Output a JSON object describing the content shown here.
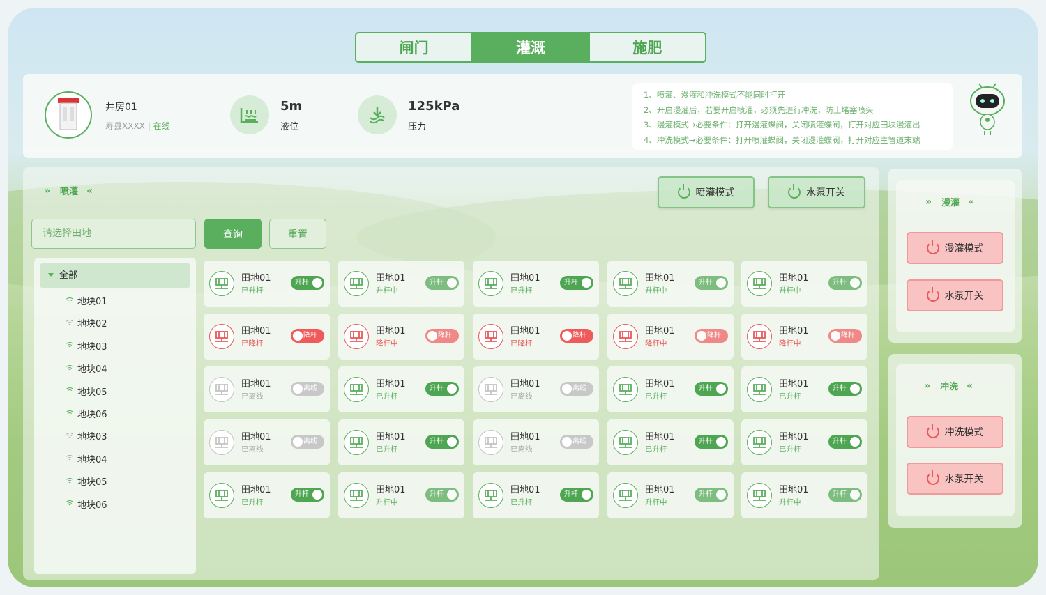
{
  "tabs": [
    {
      "label": "闸门"
    },
    {
      "label": "灌溉",
      "active": true
    },
    {
      "label": "施肥"
    }
  ],
  "header": {
    "station_name": "井房01",
    "location": "寿县XXXX",
    "separator": "|",
    "status": "在线",
    "level_value": "5m",
    "level_label": "液位",
    "pressure_value": "125kPa",
    "pressure_label": "压力",
    "notes": [
      "1、喷灌、漫灌和冲洗模式不能同时打开",
      "2、开启漫灌后，若要开启喷灌，必须先进行冲洗，防止堵塞喷头",
      "3、漫灌模式→必要条件：打开漫灌蝶阀，关闭喷灌蝶阀，打开对应田块漫灌出",
      "4、冲洗模式→必要条件：打开喷灌蝶阀，关闭漫灌蝶阀，打开对应主管道末端"
    ]
  },
  "spray": {
    "title": "喷灌",
    "mode_btn": "喷灌模式",
    "pump_btn": "水泵开关",
    "field_placeholder": "请选择田地",
    "query_btn": "查询",
    "reset_btn": "重置",
    "tree_all": "全部",
    "tree_items": [
      {
        "label": "地块01",
        "online": true
      },
      {
        "label": "地块02",
        "online": false
      },
      {
        "label": "地块03",
        "online": true
      },
      {
        "label": "地块04",
        "online": true
      },
      {
        "label": "地块05",
        "online": true
      },
      {
        "label": "地块06",
        "online": true
      },
      {
        "label": "地块03",
        "online": false
      },
      {
        "label": "地块04",
        "online": false
      },
      {
        "label": "地块05",
        "online": true
      },
      {
        "label": "地块06",
        "online": true
      }
    ]
  },
  "flood": {
    "title": "漫灌",
    "mode_btn": "漫灌模式",
    "pump_btn": "水泵开关"
  },
  "flush": {
    "title": "冲洗",
    "mode_btn": "冲洗模式",
    "pump_btn": "水泵开关"
  },
  "cards": [
    [
      {
        "name": "田地01",
        "status": "已升杆",
        "toggle": "升杆",
        "kind": "up"
      },
      {
        "name": "田地01",
        "status": "升杆中",
        "toggle": "升杆",
        "kind": "up-pending"
      },
      {
        "name": "田地01",
        "status": "已升杆",
        "toggle": "升杆",
        "kind": "up"
      },
      {
        "name": "田地01",
        "status": "升杆中",
        "toggle": "升杆",
        "kind": "up-pending"
      },
      {
        "name": "田地01",
        "status": "升杆中",
        "toggle": "升杆",
        "kind": "up-pending"
      }
    ],
    [
      {
        "name": "田地01",
        "status": "已降杆",
        "toggle": "降杆",
        "kind": "down"
      },
      {
        "name": "田地01",
        "status": "降杆中",
        "toggle": "降杆",
        "kind": "down-pending"
      },
      {
        "name": "田地01",
        "status": "已降杆",
        "toggle": "降杆",
        "kind": "down"
      },
      {
        "name": "田地01",
        "status": "降杆中",
        "toggle": "降杆",
        "kind": "down-pending"
      },
      {
        "name": "田地01",
        "status": "降杆中",
        "toggle": "降杆",
        "kind": "down-pending"
      }
    ],
    [
      {
        "name": "田地01",
        "status": "已离线",
        "toggle": "离线",
        "kind": "offline"
      },
      {
        "name": "田地01",
        "status": "已升杆",
        "toggle": "升杆",
        "kind": "up"
      },
      {
        "name": "田地01",
        "status": "已离线",
        "toggle": "离线",
        "kind": "offline"
      },
      {
        "name": "田地01",
        "status": "已升杆",
        "toggle": "升杆",
        "kind": "up"
      },
      {
        "name": "田地01",
        "status": "已升杆",
        "toggle": "升杆",
        "kind": "up"
      }
    ],
    [
      {
        "name": "田地01",
        "status": "已离线",
        "toggle": "离线",
        "kind": "offline"
      },
      {
        "name": "田地01",
        "status": "已升杆",
        "toggle": "升杆",
        "kind": "up"
      },
      {
        "name": "田地01",
        "status": "已离线",
        "toggle": "离线",
        "kind": "offline"
      },
      {
        "name": "田地01",
        "status": "已升杆",
        "toggle": "升杆",
        "kind": "up"
      },
      {
        "name": "田地01",
        "status": "已升杆",
        "toggle": "升杆",
        "kind": "up"
      }
    ],
    [
      {
        "name": "田地01",
        "status": "已升杆",
        "toggle": "升杆",
        "kind": "up"
      },
      {
        "name": "田地01",
        "status": "升杆中",
        "toggle": "升杆",
        "kind": "up-pending"
      },
      {
        "name": "田地01",
        "status": "已升杆",
        "toggle": "升杆",
        "kind": "up"
      },
      {
        "name": "田地01",
        "status": "升杆中",
        "toggle": "升杆",
        "kind": "up-pending"
      },
      {
        "name": "田地01",
        "status": "升杆中",
        "toggle": "升杆",
        "kind": "up-pending"
      }
    ]
  ],
  "colors": {
    "accent": "#5aaf5e",
    "danger": "#e85959",
    "offline": "#c8c8c8"
  }
}
